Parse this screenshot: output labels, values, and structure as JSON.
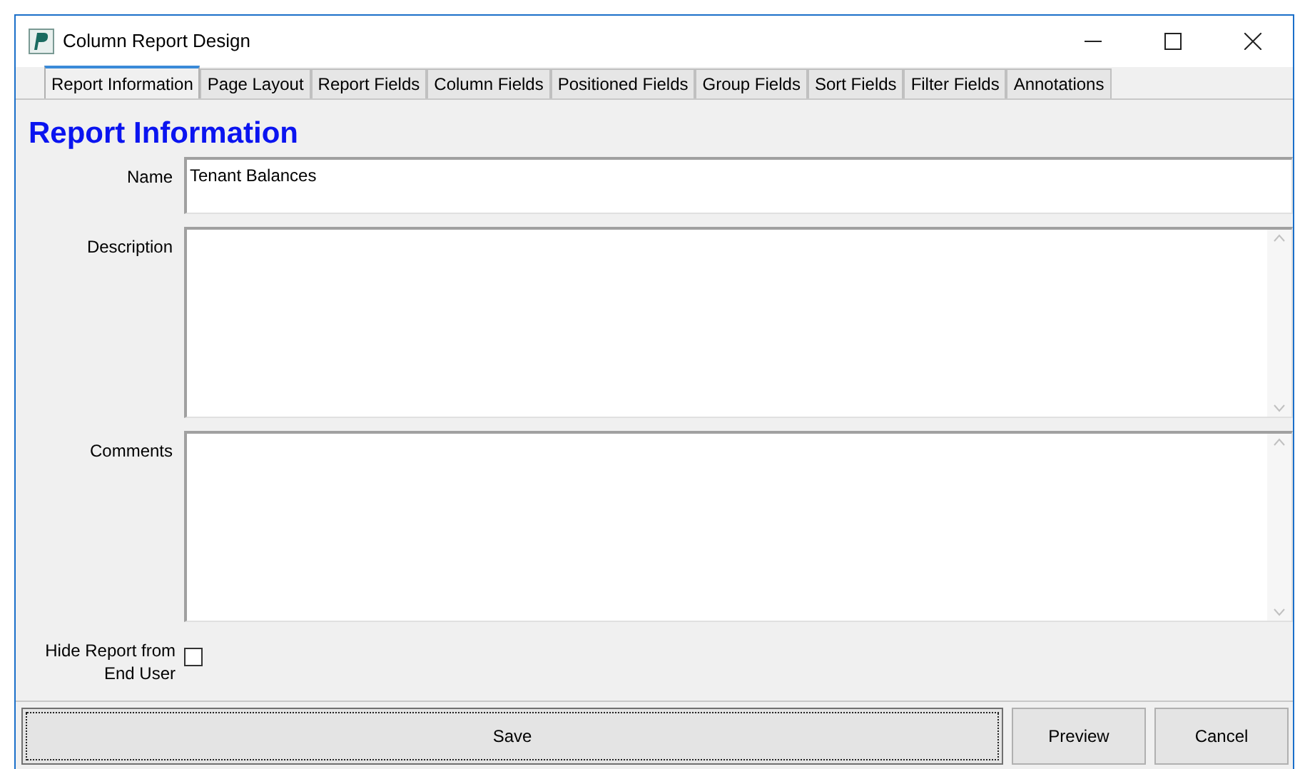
{
  "window": {
    "title": "Column Report Design"
  },
  "tabs": [
    {
      "label": "Report Information",
      "selected": true
    },
    {
      "label": "Page Layout",
      "selected": false
    },
    {
      "label": "Report Fields",
      "selected": false
    },
    {
      "label": "Column Fields",
      "selected": false
    },
    {
      "label": "Positioned Fields",
      "selected": false
    },
    {
      "label": "Group Fields",
      "selected": false
    },
    {
      "label": "Sort Fields",
      "selected": false
    },
    {
      "label": "Filter Fields",
      "selected": false
    },
    {
      "label": "Annotations",
      "selected": false
    }
  ],
  "heading": "Report Information",
  "form": {
    "name": {
      "label": "Name",
      "value": "Tenant Balances"
    },
    "description": {
      "label": "Description"
    },
    "comments": {
      "label": "Comments"
    },
    "hide_report": {
      "label": "Hide Report from End User",
      "checked": false
    }
  },
  "buttons": [
    {
      "label": "Save",
      "kind": "primary"
    },
    {
      "label": "Preview",
      "kind": "normal"
    },
    {
      "label": "Cancel",
      "kind": "normal"
    }
  ]
}
